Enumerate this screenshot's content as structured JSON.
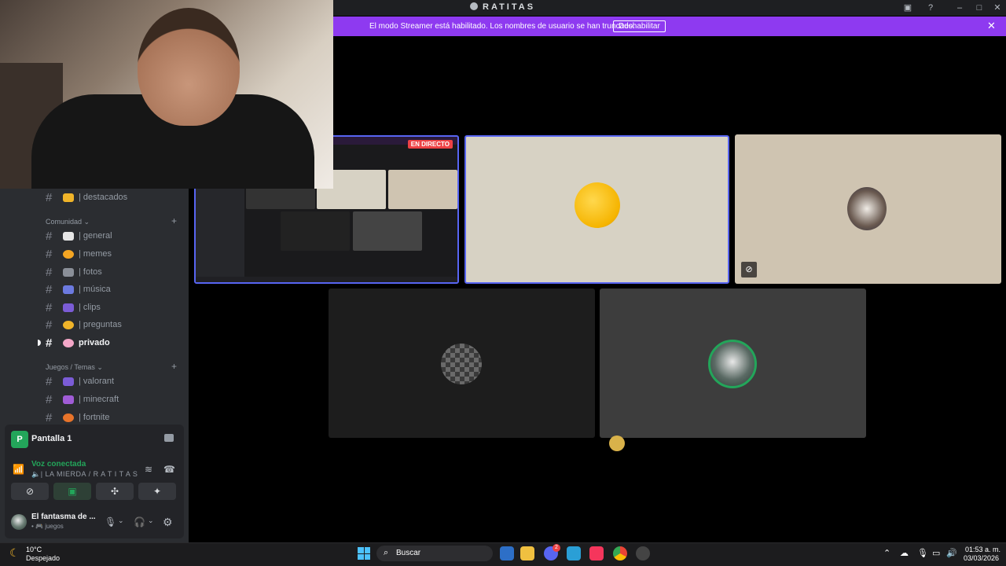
{
  "window": {
    "title": "RATITAS",
    "controls": [
      "screen-share-icon",
      "help-icon",
      "minimize-icon",
      "maximize-icon",
      "close-icon"
    ]
  },
  "banner": {
    "message": "El modo Streamer está habilitado. Los nombres de usuario se han truncado.",
    "button_label": "Deshabilitar",
    "color": "#8e3af0"
  },
  "sidebar": {
    "channels_top": [
      {
        "emoji": "star",
        "label": "| destacados"
      }
    ],
    "categories": [
      {
        "label": "Comunidad",
        "channels": [
          {
            "label": "| general"
          },
          {
            "label": "| memes"
          },
          {
            "label": "| fotos"
          },
          {
            "label": "| música"
          },
          {
            "label": "| clips"
          },
          {
            "label": "| preguntas"
          },
          {
            "label": "privado",
            "active": true
          }
        ]
      },
      {
        "label": "Juegos / Temas",
        "channels": [
          {
            "label": "| valorant"
          },
          {
            "label": "| minecraft"
          },
          {
            "label": "| fortnite"
          }
        ]
      }
    ]
  },
  "screen_panel": {
    "title": "Pantalla 1",
    "badge_letter": "P",
    "voice_status": "Voz conectada",
    "voice_channel": "🔈| LA MIERDA / R A T I T A S"
  },
  "user": {
    "name": "El fantasma de ...",
    "status": "• 🎮 juegos"
  },
  "stage": {
    "live_badge": "EN DIRECTO"
  },
  "taskbar": {
    "weather_temp": "10°C",
    "weather_desc": "Despejado",
    "search_placeholder": "Buscar",
    "discord_badge": "2",
    "clock_time": "01:53 a. m.",
    "clock_date": "03/03/2026"
  },
  "colors": {
    "accent": "#5865f2",
    "online": "#23a55a",
    "live": "#ed4245"
  }
}
